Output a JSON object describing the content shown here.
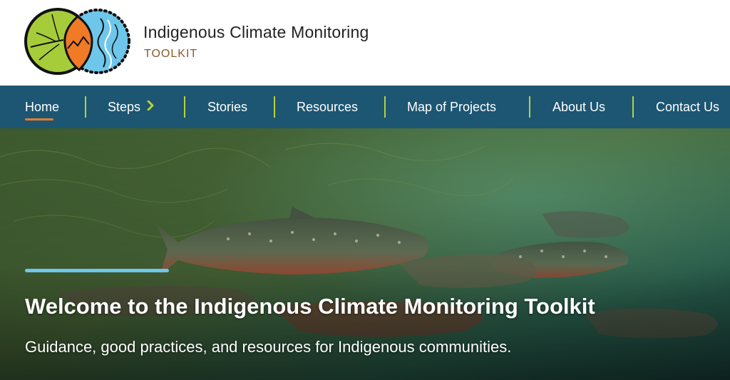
{
  "site": {
    "title": "Indigenous Climate Monitoring",
    "subtitle": "TOOLKIT"
  },
  "nav": {
    "items": [
      {
        "label": "Home",
        "active": true
      },
      {
        "label": "Steps",
        "has_submenu": true,
        "icon": "chevron-right-icon"
      },
      {
        "label": "Stories"
      },
      {
        "label": "Resources"
      },
      {
        "label": "Map of Projects"
      },
      {
        "label": "About Us"
      },
      {
        "label": "Contact Us"
      }
    ]
  },
  "hero": {
    "title": "Welcome to the Indigenous Climate Monitoring Toolkit",
    "subtitle": "Guidance, good practices, and resources for Indigenous communities."
  },
  "colors": {
    "nav_background": "#1c5672",
    "nav_separator": "#b7d23c",
    "active_underline": "#f07a26",
    "hero_accent_bar": "#6ec7ea",
    "subtitle_color": "#8a5a2b",
    "logo_green": "#a6cc3a",
    "logo_orange": "#f07a26",
    "logo_blue": "#6ec7ea"
  }
}
